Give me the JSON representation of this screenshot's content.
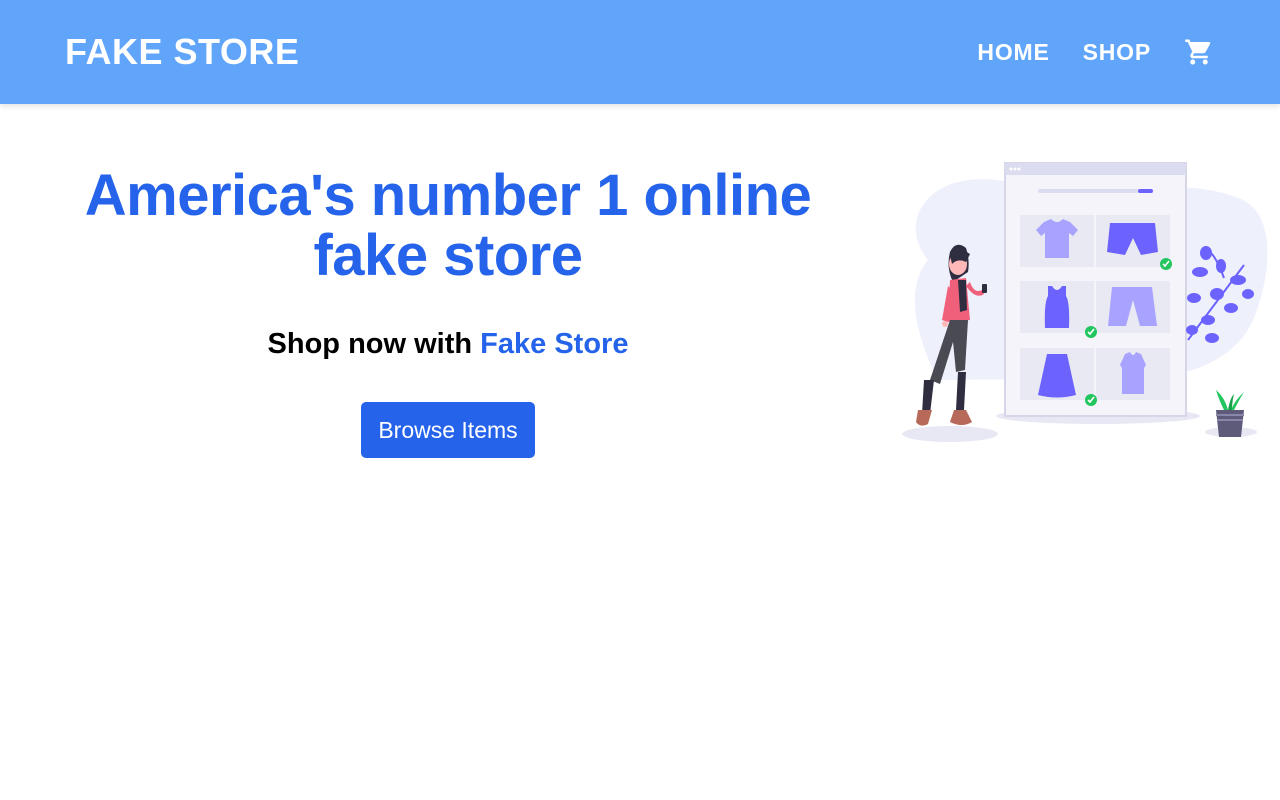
{
  "navbar": {
    "brand": "FAKE STORE",
    "links": [
      {
        "label": "HOME"
      },
      {
        "label": "SHOP"
      }
    ],
    "cart_icon": "shopping-cart-icon"
  },
  "hero": {
    "headline_line1": "America's number 1 online",
    "headline_line2": "fake store",
    "subline_prefix": "Shop now with",
    "subline_accent": "Fake Store",
    "cta_label": "Browse Items",
    "illustration": "online-shopping-illustration"
  },
  "colors": {
    "navbar_bg": "#60a5fa",
    "accent": "#2563eb",
    "illustration_purple": "#6c63ff",
    "check_green": "#22c55e"
  }
}
